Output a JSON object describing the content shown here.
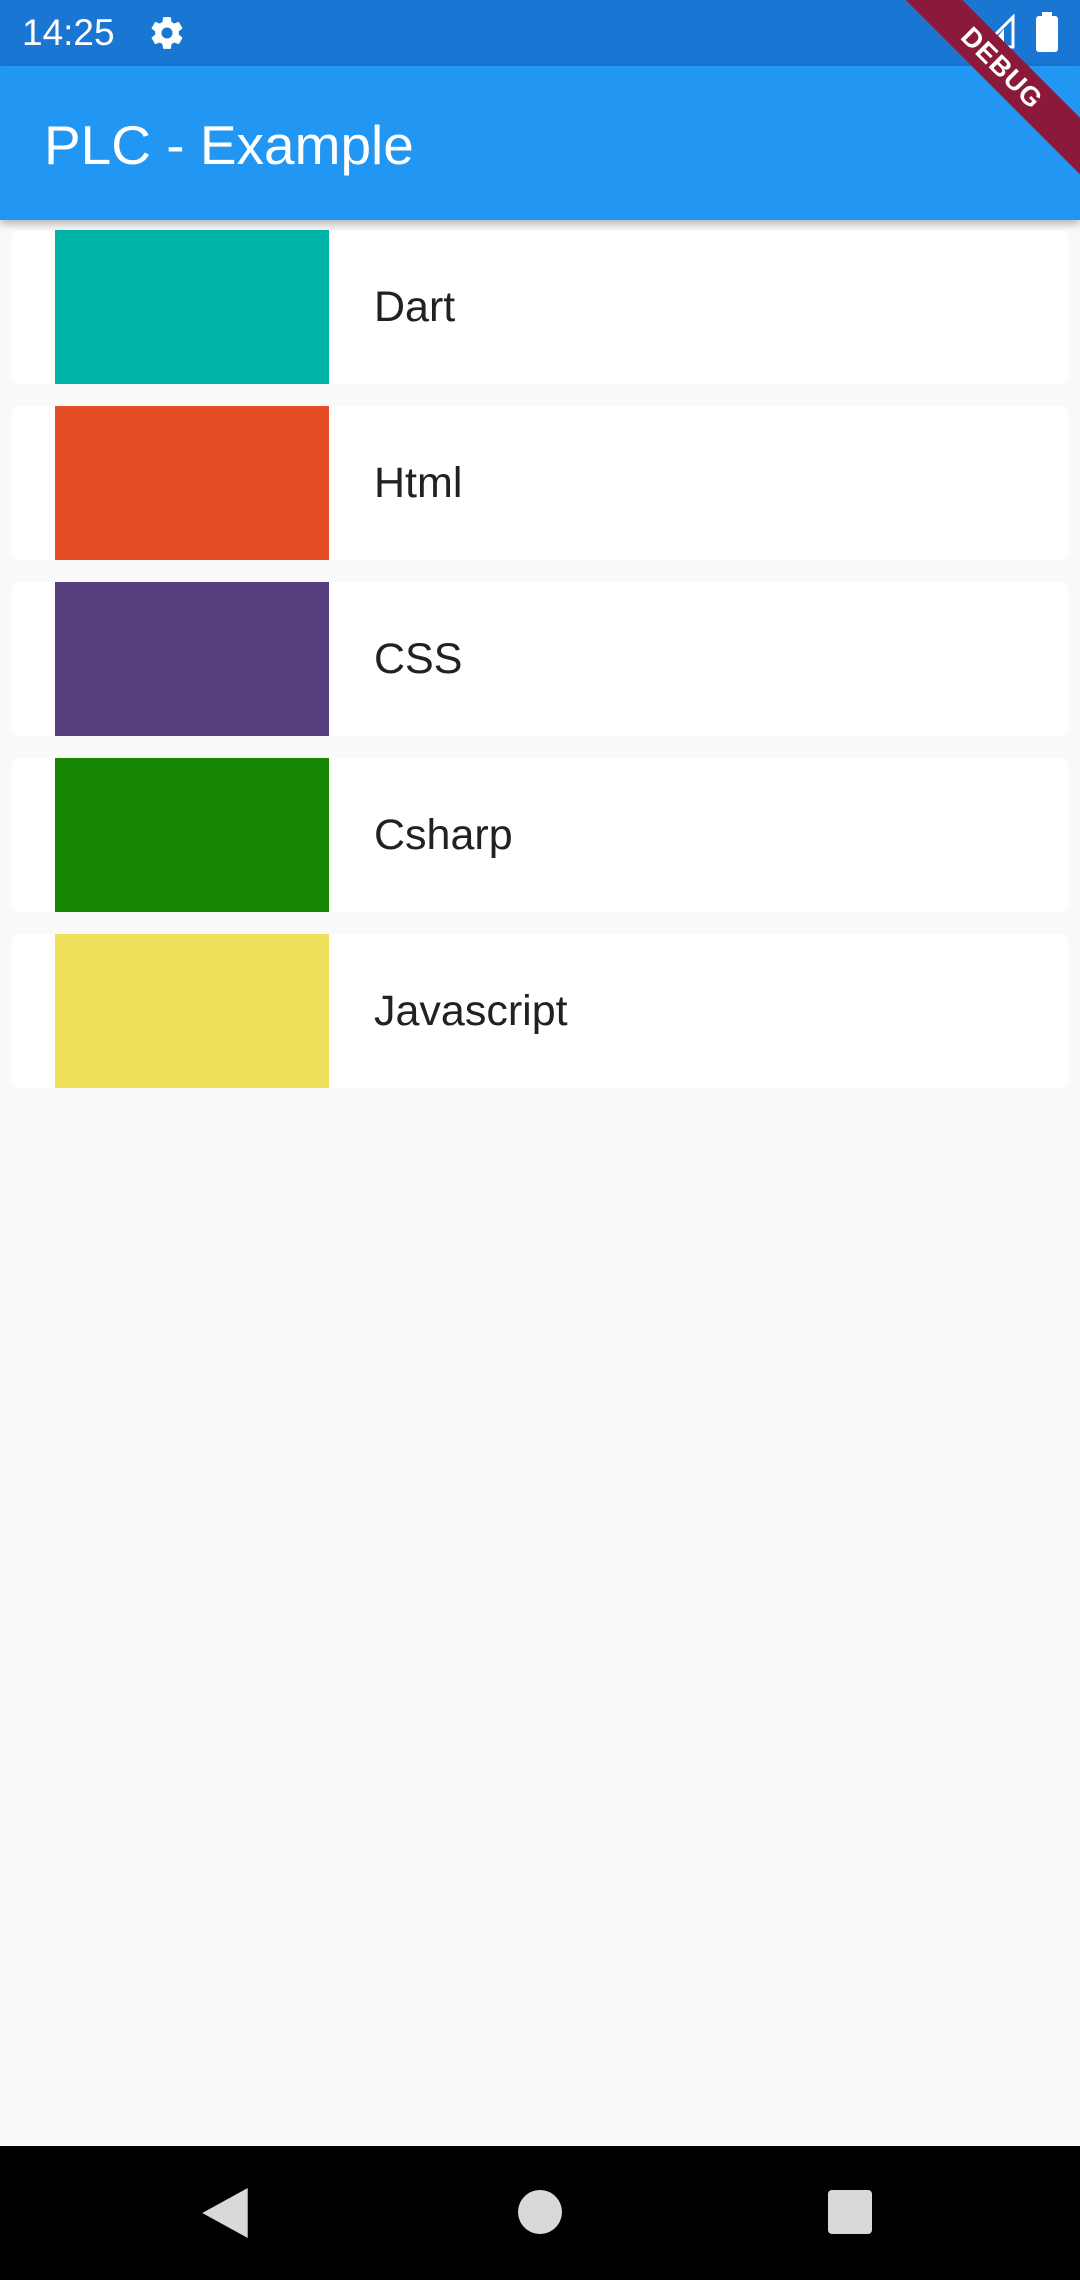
{
  "status_bar": {
    "time": "14:25",
    "icons": [
      "gear-icon",
      "wifi-icon",
      "signal-icon",
      "battery-icon"
    ]
  },
  "app_bar": {
    "title": "PLC - Example",
    "color": "#2196f3"
  },
  "debug_banner": {
    "label": "DEBUG"
  },
  "list": {
    "items": [
      {
        "label": "Dart",
        "color": "#00b3a7"
      },
      {
        "label": "Html",
        "color": "#e44d26"
      },
      {
        "label": "CSS",
        "color": "#563d7c"
      },
      {
        "label": "Csharp",
        "color": "#178600"
      },
      {
        "label": "Javascript",
        "color": "#f1e05a"
      }
    ]
  },
  "nav_bar": {
    "icons": [
      "back-icon",
      "home-icon",
      "recents-icon"
    ]
  }
}
